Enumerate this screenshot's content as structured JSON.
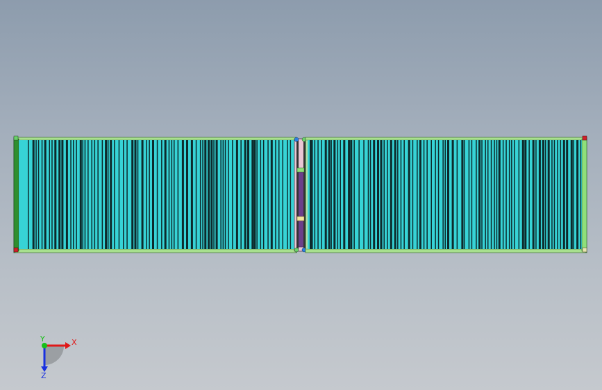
{
  "view": {
    "background_top": "#8d9cad",
    "background_bottom": "#c5c9ce"
  },
  "model": {
    "name": "conveyor-assembly",
    "colors": {
      "roller_cyan": "#37d3d6",
      "roller_dark": "#0d2a2c",
      "frame_green": "#8fdf7a",
      "frame_dark_green": "#2f8f2f",
      "center_pink": "#e9c6d4",
      "center_purple": "#6b3f8a",
      "corner_red": "#d01f2a",
      "corner_blue": "#2a7fe0",
      "corner_green": "#6ad06a"
    },
    "sections": [
      {
        "name": "left-conveyor-section"
      },
      {
        "name": "right-conveyor-section"
      }
    ]
  },
  "triad": {
    "x_label": "X",
    "y_label": "Y",
    "z_label": "Z",
    "x_color": "#e01818",
    "y_color": "#18c018",
    "z_color": "#1830e0"
  }
}
